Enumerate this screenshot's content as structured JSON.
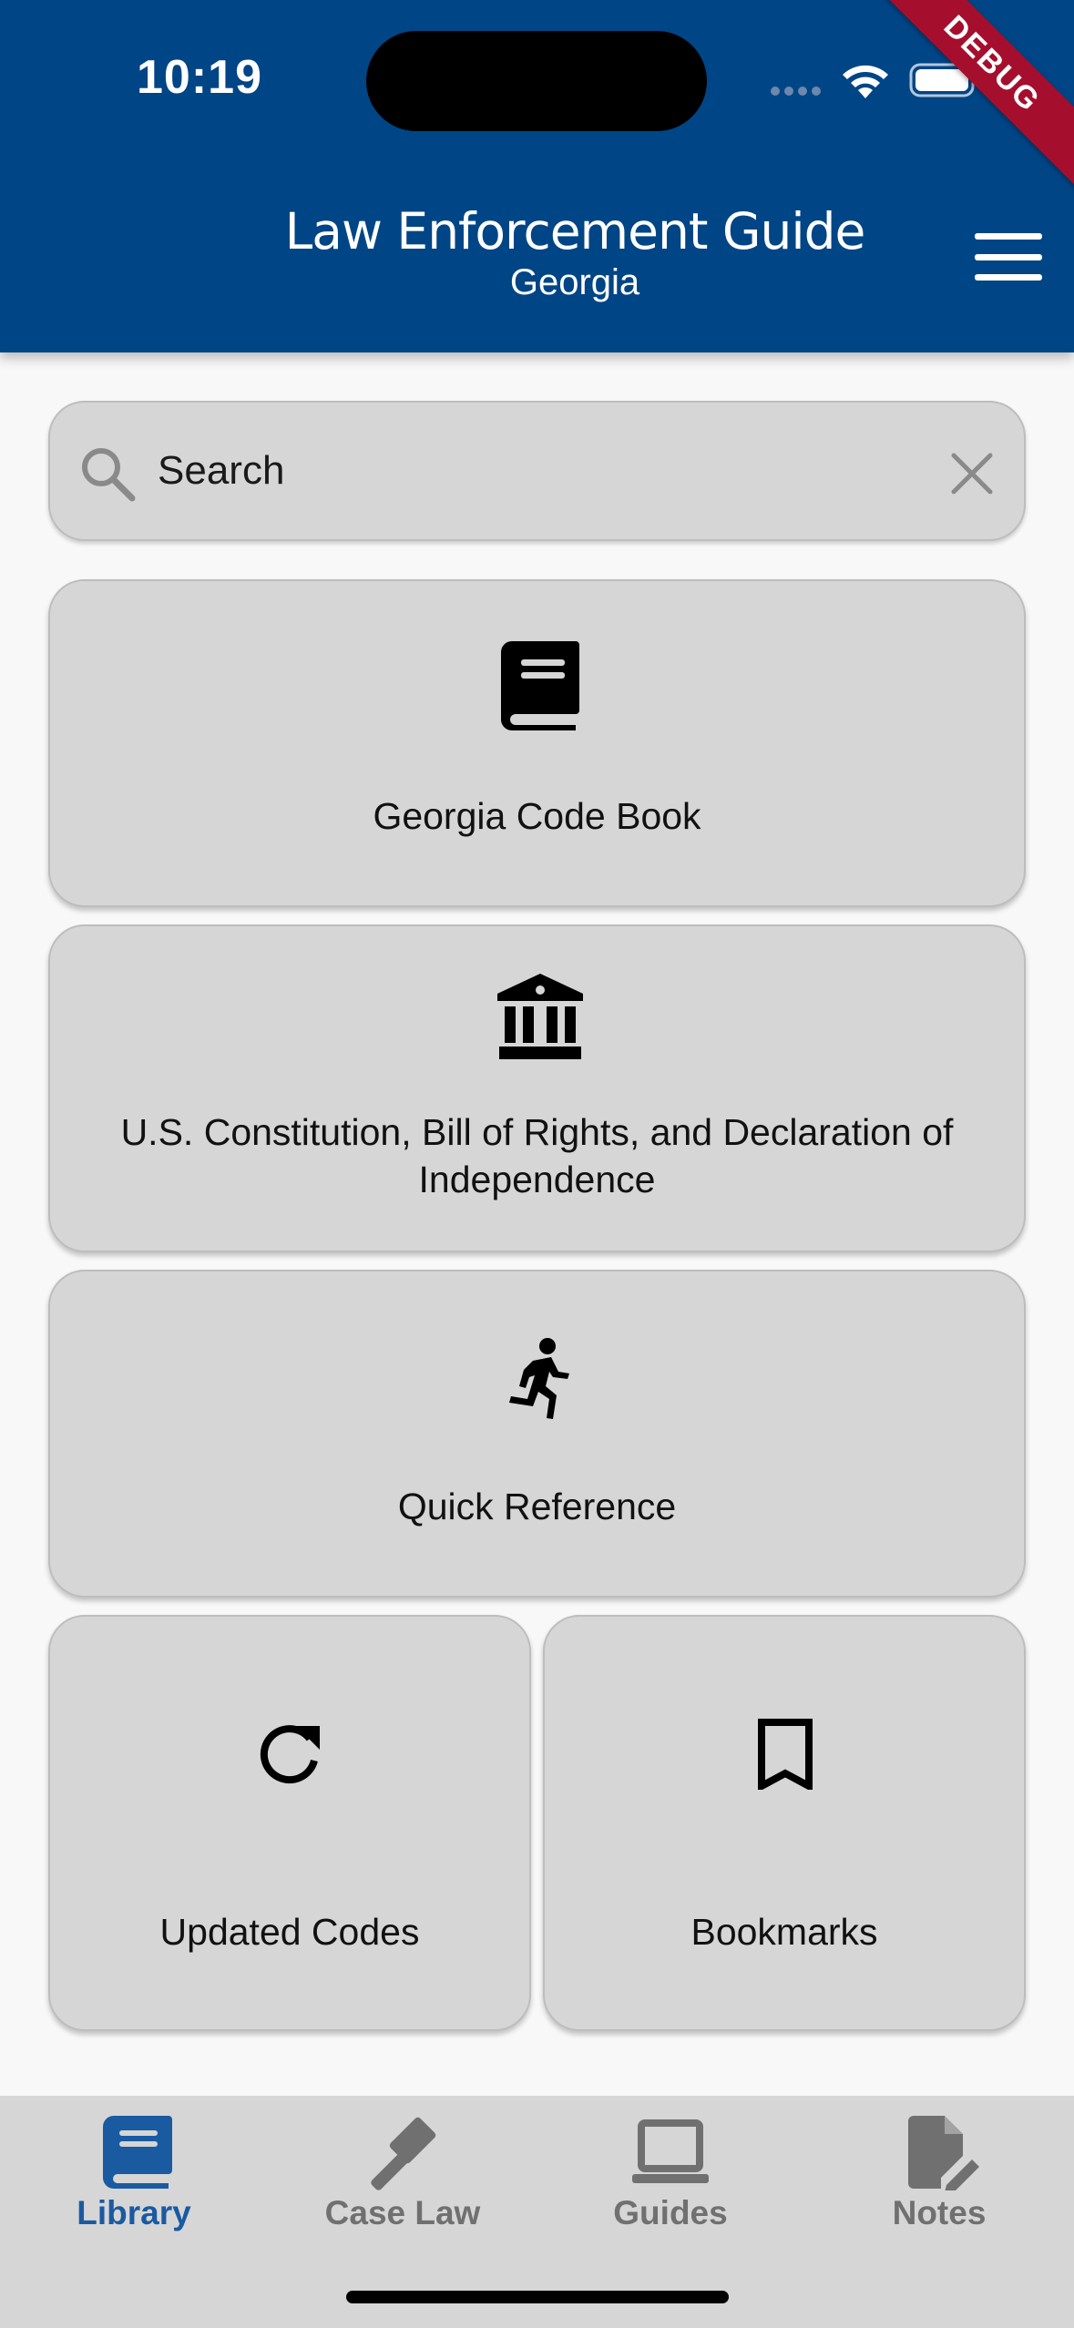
{
  "status_bar": {
    "time": "10:19",
    "debug_label": "DEBUG"
  },
  "header": {
    "title": "Law Enforcement Guide",
    "subtitle": "Georgia"
  },
  "search": {
    "placeholder": "Search"
  },
  "cards": {
    "code_book": {
      "label": "Georgia Code Book",
      "icon": "book-icon"
    },
    "constitution": {
      "label": "U.S. Constitution, Bill of Rights, and Declaration of Independence",
      "icon": "bank-icon"
    },
    "quick_reference": {
      "label": "Quick Reference",
      "icon": "running-person-icon"
    },
    "updated_codes": {
      "label": "Updated Codes",
      "icon": "refresh-icon"
    },
    "bookmarks": {
      "label": "Bookmarks",
      "icon": "bookmark-icon"
    }
  },
  "bottom_nav": {
    "items": [
      {
        "label": "Library",
        "icon": "book-icon",
        "active": true
      },
      {
        "label": "Case Law",
        "icon": "gavel-icon",
        "active": false
      },
      {
        "label": "Guides",
        "icon": "laptop-icon",
        "active": false
      },
      {
        "label": "Notes",
        "icon": "note-edit-icon",
        "active": false
      }
    ]
  },
  "colors": {
    "header_bg": "#004586",
    "card_bg": "#d6d6d6",
    "active_nav": "#1a5aa1",
    "inactive_nav": "#707070",
    "debug_banner": "#a50f2d"
  }
}
